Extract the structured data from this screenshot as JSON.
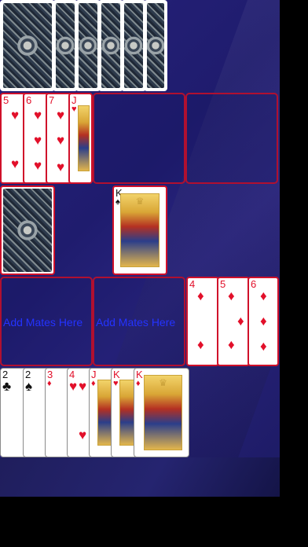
{
  "colors": {
    "felt": "#27227a",
    "slot_border": "#b01030",
    "label": "#2433ff",
    "red_suit": "#e2102a",
    "black_suit": "#111111"
  },
  "stock": {
    "icon": "card-back-pattern"
  },
  "slots": {
    "mates_label_1": "Add Mates Here",
    "mates_label_2": "Add Mates Here"
  },
  "row1_cards": [
    {
      "rank": "5",
      "suit": "♥"
    },
    {
      "rank": "6",
      "suit": "♥"
    },
    {
      "rank": "7",
      "suit": "♥"
    },
    {
      "rank": "J",
      "suit": "♥"
    }
  ],
  "row2_card": {
    "rank": "K",
    "suit": "♠"
  },
  "row3_cards": [
    {
      "rank": "4",
      "suit": "♦"
    },
    {
      "rank": "5",
      "suit": "♦"
    },
    {
      "rank": "6",
      "suit": "♦"
    }
  ],
  "hand_cards": [
    {
      "rank": "2",
      "suit": "♣"
    },
    {
      "rank": "2",
      "suit": "♠"
    },
    {
      "rank": "3",
      "suit": "♦"
    },
    {
      "rank": "4",
      "suit": "♥"
    },
    {
      "rank": "J",
      "suit": "♦"
    },
    {
      "rank": "K",
      "suit": "♥"
    },
    {
      "rank": "K",
      "suit": "♦"
    }
  ]
}
